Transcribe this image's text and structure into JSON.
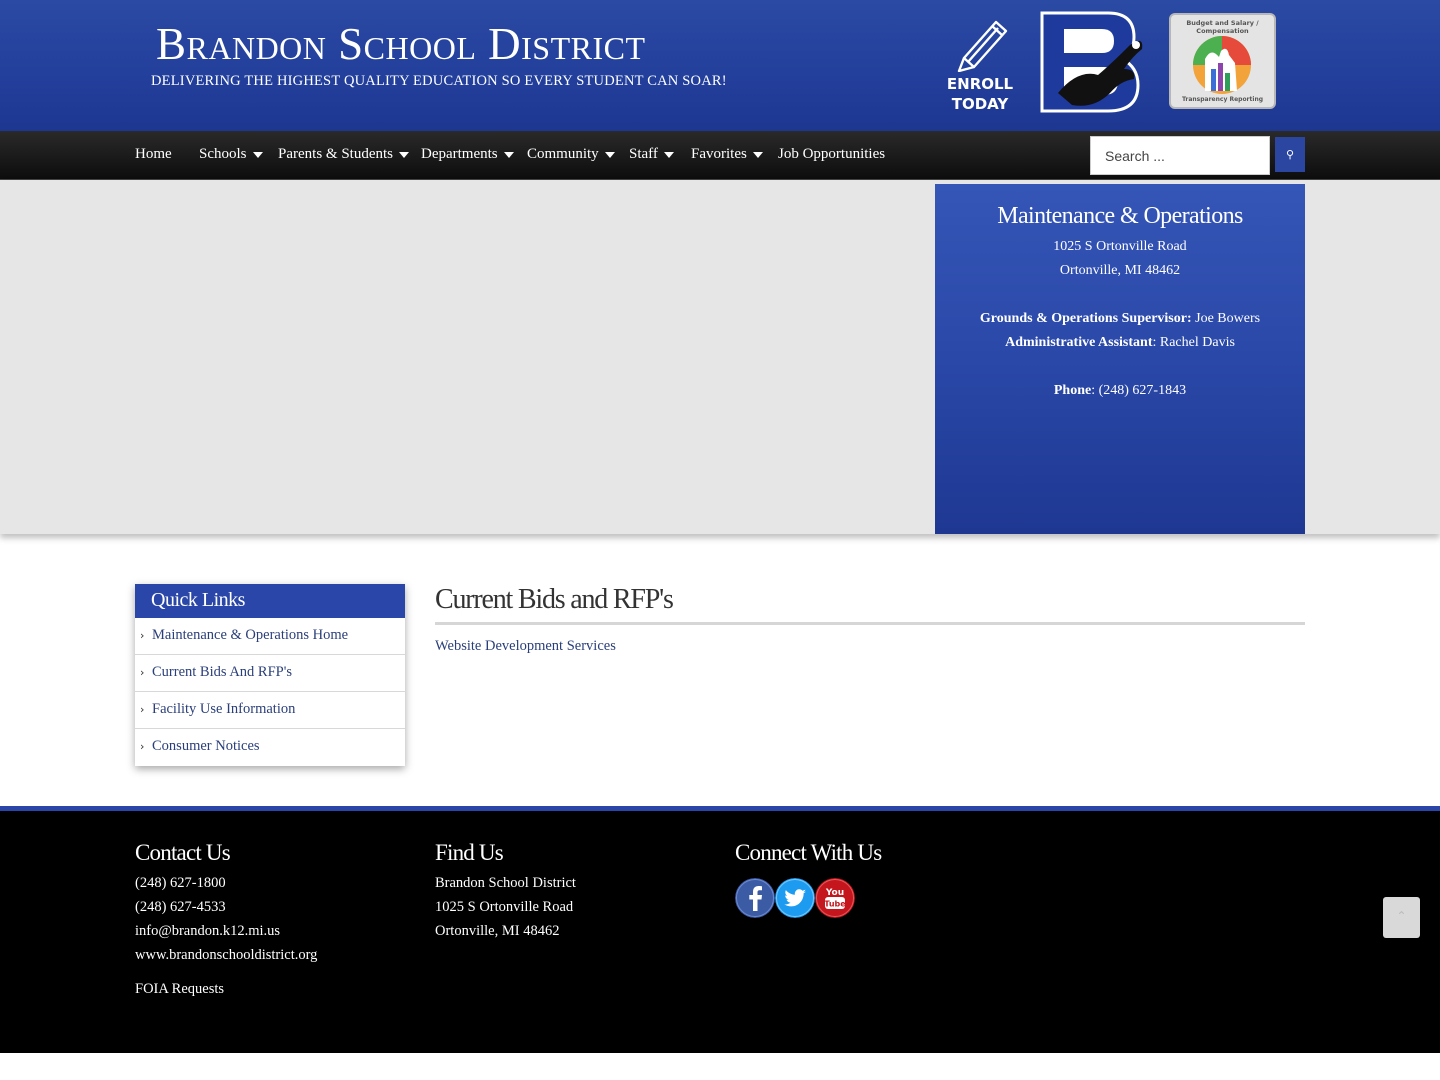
{
  "header": {
    "title": "Brandon School District",
    "tagline": "DELIVERING THE HIGHEST QUALITY EDUCATION SO EVERY STUDENT CAN SOAR!",
    "enroll_label": "ENROLL\nTODAY",
    "transparency_top": "Budget and Salary / Compensation",
    "transparency_bottom": "Transparency Reporting",
    "brand_color": "#23409c"
  },
  "nav": {
    "items": [
      {
        "label": "Home",
        "dropdown": false
      },
      {
        "label": "Schools",
        "dropdown": true
      },
      {
        "label": "Parents & Students",
        "dropdown": true
      },
      {
        "label": "Departments",
        "dropdown": true
      },
      {
        "label": "Community",
        "dropdown": true
      },
      {
        "label": "Staff",
        "dropdown": true
      },
      {
        "label": "Favorites",
        "dropdown": true
      },
      {
        "label": "Job Opportunities",
        "dropdown": false
      }
    ],
    "search_placeholder": "Search ...",
    "search_button_icon": "search-icon"
  },
  "hero": {
    "info": {
      "title": "Maintenance & Operations",
      "address_line1": "1025 S Ortonville Road",
      "address_line2": "Ortonville, MI 48462",
      "supervisor_label": "Grounds & Operations Supervisor:",
      "supervisor_name": "Joe Bowers",
      "assistant_label": "Administrative Assistant",
      "assistant_name": ": Rachel Davis",
      "phone_label": "Phone",
      "phone_value": ": (248) 627-1843"
    }
  },
  "quick_links": {
    "title": "Quick Links",
    "items": [
      {
        "label": "Maintenance & Operations Home"
      },
      {
        "label": "Current Bids And RFP's"
      },
      {
        "label": "Facility Use Information"
      },
      {
        "label": "Consumer Notices"
      }
    ]
  },
  "main": {
    "heading": "Current Bids and RFP's",
    "links": [
      {
        "label": "Website Development Services"
      }
    ]
  },
  "footer": {
    "contact": {
      "heading": "Contact Us",
      "phone1": "(248) 627-1800",
      "phone2": "(248) 627-4533",
      "email": "info@brandon.k12.mi.us",
      "website": "www.brandonschooldistrict.org",
      "foia": "FOIA Requests"
    },
    "find": {
      "heading": "Find Us",
      "line1": "Brandon School District",
      "line2": "1025 S Ortonville Road",
      "line3": "Ortonville, MI 48462"
    },
    "connect": {
      "heading": "Connect With Us",
      "networks": [
        "facebook-icon",
        "twitter-icon",
        "youtube-icon"
      ]
    }
  }
}
